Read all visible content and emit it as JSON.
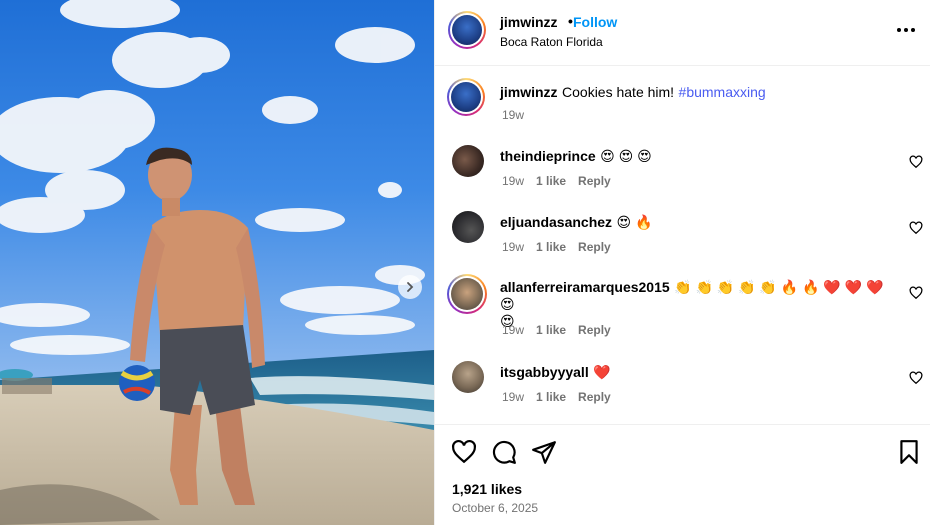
{
  "post": {
    "username": "jimwinzz",
    "dot": "•",
    "follow_label": "Follow",
    "location": "Boca Raton Florida",
    "caption_text": "Cookies hate him!",
    "caption_hashtag": "#bummaxxing",
    "caption_time": "19w",
    "likes": "1,921 likes",
    "date": "October 6, 2025"
  },
  "comments": [
    {
      "username": "theindieprince",
      "text": "😍 😍 😍",
      "time": "19w",
      "likes": "1 like",
      "reply": "Reply"
    },
    {
      "username": "eljuandasanchez",
      "text": "😍 🔥",
      "time": "19w",
      "likes": "1 like",
      "reply": "Reply"
    },
    {
      "username": "allanferreiramarques2015",
      "text": "👏 👏 👏 👏 👏 🔥 🔥 ❤️ ❤️ ❤️ 😍",
      "text2": "😍",
      "time": "19w",
      "likes": "1 like",
      "reply": "Reply"
    },
    {
      "username": "itsgabbyyyall",
      "text": "❤️",
      "time": "19w",
      "likes": "1 like",
      "reply": "Reply"
    }
  ],
  "icons": {
    "more": "more-horizontal-icon",
    "next": "chevron-right-icon",
    "like": "heart-icon",
    "comment": "comment-icon",
    "share": "send-icon",
    "save": "bookmark-icon"
  },
  "colors": {
    "follow": "#0095f6",
    "hashtag": "#4a5cf0",
    "muted": "#737373",
    "border": "#efefef"
  }
}
